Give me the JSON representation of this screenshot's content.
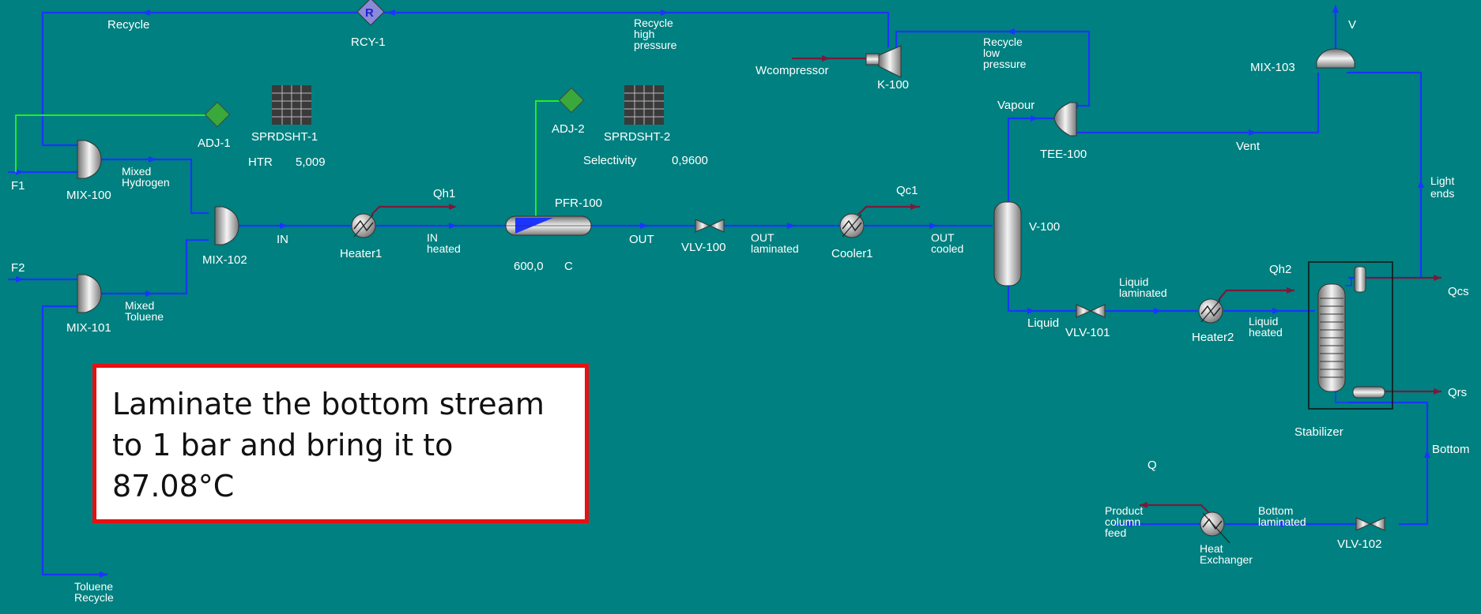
{
  "diagram": {
    "background": "#008080",
    "material_stream_color": "#1b35ff",
    "energy_stream_color": "#7a1a3a",
    "adjust_link_color": "#22ee22"
  },
  "units": {
    "rcy1": "RCY-1",
    "rcy1_glyph": "R",
    "adj1": "ADJ-1",
    "adj2": "ADJ-2",
    "sprdsht1": "SPRDSHT-1",
    "sprdsht2": "SPRDSHT-2",
    "mix100": "MIX-100",
    "mix101": "MIX-101",
    "mix102": "MIX-102",
    "mix103": "MIX-103",
    "heater1": "Heater1",
    "heater2": "Heater2",
    "pfr100": "PFR-100",
    "vlv100": "VLV-100",
    "vlv101": "VLV-101",
    "vlv102": "VLV-102",
    "cooler1": "Cooler1",
    "v100": "V-100",
    "tee100": "TEE-100",
    "k100": "K-100",
    "stabilizer": "Stabilizer",
    "heat_exchanger": [
      "Heat",
      "Exchanger"
    ]
  },
  "readouts": {
    "htr_label": "HTR",
    "htr_value": "5,009",
    "selectivity_label": "Selectivity",
    "selectivity_value": "0,9600",
    "pfr_temp": "600,0",
    "pfr_unit": "C"
  },
  "streams": {
    "recycle": "Recycle",
    "recycle_high": [
      "Recycle",
      "high",
      "pressure"
    ],
    "recycle_low": [
      "Recycle",
      "low",
      "pressure"
    ],
    "wcompressor": "Wcompressor",
    "v": "V",
    "f1": "F1",
    "f2": "F2",
    "mixed_hydrogen": [
      "Mixed",
      "Hydrogen"
    ],
    "mixed_toluene": [
      "Mixed",
      "Toluene"
    ],
    "in": "IN",
    "in_heated": [
      "IN",
      "heated"
    ],
    "qh1": "Qh1",
    "out": "OUT",
    "out_laminated": [
      "OUT",
      "laminated"
    ],
    "qc1": "Qc1",
    "out_cooled": [
      "OUT",
      "cooled"
    ],
    "vapour": "Vapour",
    "vent": "Vent",
    "light_ends": [
      "Light",
      "ends"
    ],
    "liquid": "Liquid",
    "liquid_laminated": [
      "Liquid",
      "laminated"
    ],
    "qh2": "Qh2",
    "liquid_heated": [
      "Liquid",
      "heated"
    ],
    "qcs": "Qcs",
    "qrs": "Qrs",
    "bottom": "Bottom",
    "bottom_laminated": [
      "Bottom",
      "laminated"
    ],
    "q": "Q",
    "product_column_feed": [
      "Product",
      "column",
      "feed"
    ],
    "toluene_recycle": [
      "Toluene",
      "Recycle"
    ]
  },
  "annotation": {
    "text": "Laminate the bottom stream to 1 bar and bring it to 87.08°C",
    "border_color": "#e81010"
  }
}
